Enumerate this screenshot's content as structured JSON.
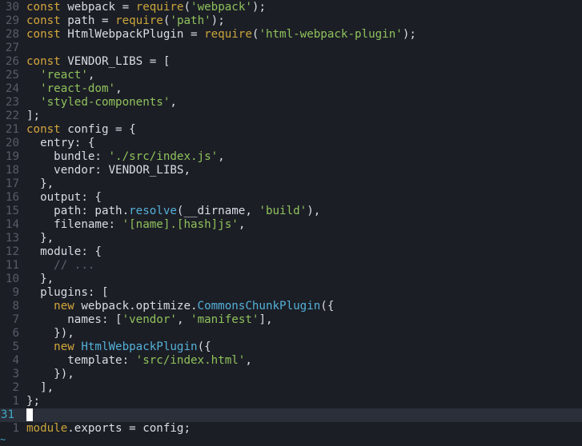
{
  "editor": {
    "lines": [
      {
        "num": "30",
        "tokens": [
          [
            "kw",
            "const"
          ],
          [
            "pl",
            " webpack = "
          ],
          [
            "fn",
            "require"
          ],
          [
            "pl",
            "("
          ],
          [
            "str",
            "'webpack'"
          ],
          [
            "pl",
            ");"
          ]
        ]
      },
      {
        "num": "29",
        "tokens": [
          [
            "kw",
            "const"
          ],
          [
            "pl",
            " path = "
          ],
          [
            "fn",
            "require"
          ],
          [
            "pl",
            "("
          ],
          [
            "str",
            "'path'"
          ],
          [
            "pl",
            ");"
          ]
        ]
      },
      {
        "num": "28",
        "tokens": [
          [
            "kw",
            "const"
          ],
          [
            "pl",
            " HtmlWebpackPlugin = "
          ],
          [
            "fn",
            "require"
          ],
          [
            "pl",
            "("
          ],
          [
            "str",
            "'html-webpack-plugin'"
          ],
          [
            "pl",
            ");"
          ]
        ]
      },
      {
        "num": "27",
        "tokens": []
      },
      {
        "num": "26",
        "tokens": [
          [
            "kw",
            "const"
          ],
          [
            "pl",
            " VENDOR_LIBS = ["
          ]
        ]
      },
      {
        "num": "25",
        "tokens": [
          [
            "pl",
            "  "
          ],
          [
            "str",
            "'react'"
          ],
          [
            "pl",
            ","
          ]
        ]
      },
      {
        "num": "24",
        "tokens": [
          [
            "pl",
            "  "
          ],
          [
            "str",
            "'react-dom'"
          ],
          [
            "pl",
            ","
          ]
        ]
      },
      {
        "num": "23",
        "tokens": [
          [
            "pl",
            "  "
          ],
          [
            "str",
            "'styled-components'"
          ],
          [
            "pl",
            ","
          ]
        ]
      },
      {
        "num": "22",
        "tokens": [
          [
            "pl",
            "];"
          ]
        ]
      },
      {
        "num": "21",
        "tokens": [
          [
            "kw",
            "const"
          ],
          [
            "pl",
            " config = {"
          ]
        ]
      },
      {
        "num": "20",
        "tokens": [
          [
            "pl",
            "  entry: {"
          ]
        ]
      },
      {
        "num": "19",
        "tokens": [
          [
            "pl",
            "    bundle: "
          ],
          [
            "str",
            "'./src/index.js'"
          ],
          [
            "pl",
            ","
          ]
        ]
      },
      {
        "num": "18",
        "tokens": [
          [
            "pl",
            "    vendor: VENDOR_LIBS,"
          ]
        ]
      },
      {
        "num": "17",
        "tokens": [
          [
            "pl",
            "  },"
          ]
        ]
      },
      {
        "num": "16",
        "tokens": [
          [
            "pl",
            "  output: {"
          ]
        ]
      },
      {
        "num": "15",
        "tokens": [
          [
            "pl",
            "    path: path."
          ],
          [
            "method",
            "resolve"
          ],
          [
            "pl",
            "(__dirname, "
          ],
          [
            "str",
            "'build'"
          ],
          [
            "pl",
            "),"
          ]
        ]
      },
      {
        "num": "14",
        "tokens": [
          [
            "pl",
            "    filename: "
          ],
          [
            "str",
            "'[name].[hash]js'"
          ],
          [
            "pl",
            ","
          ]
        ]
      },
      {
        "num": "13",
        "tokens": [
          [
            "pl",
            "  },"
          ]
        ]
      },
      {
        "num": "12",
        "tokens": [
          [
            "pl",
            "  module: {"
          ]
        ]
      },
      {
        "num": "11",
        "tokens": [
          [
            "pl",
            "    "
          ],
          [
            "cm",
            "// ..."
          ]
        ]
      },
      {
        "num": "10",
        "tokens": [
          [
            "pl",
            "  },"
          ]
        ]
      },
      {
        "num": "9",
        "tokens": [
          [
            "pl",
            "  plugins: ["
          ]
        ]
      },
      {
        "num": "8",
        "tokens": [
          [
            "pl",
            "    "
          ],
          [
            "kw",
            "new"
          ],
          [
            "pl",
            " webpack.optimize."
          ],
          [
            "method",
            "CommonsChunkPlugin"
          ],
          [
            "pl",
            "({"
          ]
        ]
      },
      {
        "num": "7",
        "tokens": [
          [
            "pl",
            "      names: ["
          ],
          [
            "str",
            "'vendor'"
          ],
          [
            "pl",
            ", "
          ],
          [
            "str",
            "'manifest'"
          ],
          [
            "pl",
            "],"
          ]
        ]
      },
      {
        "num": "6",
        "tokens": [
          [
            "pl",
            "    }),"
          ]
        ]
      },
      {
        "num": "5",
        "tokens": [
          [
            "pl",
            "    "
          ],
          [
            "kw",
            "new"
          ],
          [
            "pl",
            " "
          ],
          [
            "method",
            "HtmlWebpackPlugin"
          ],
          [
            "pl",
            "({"
          ]
        ]
      },
      {
        "num": "4",
        "tokens": [
          [
            "pl",
            "      template: "
          ],
          [
            "str",
            "'src/index.html'"
          ],
          [
            "pl",
            ","
          ]
        ]
      },
      {
        "num": "3",
        "tokens": [
          [
            "pl",
            "    }),"
          ]
        ]
      },
      {
        "num": "2",
        "tokens": [
          [
            "pl",
            "  ],"
          ]
        ]
      },
      {
        "num": "1",
        "tokens": [
          [
            "pl",
            "};"
          ]
        ]
      },
      {
        "num": "31",
        "tokens": [],
        "current": true
      },
      {
        "num": "1",
        "tokens": [
          [
            "fn",
            "module"
          ],
          [
            "pl",
            ".exports = config;"
          ]
        ]
      }
    ],
    "end_marker": "~"
  }
}
